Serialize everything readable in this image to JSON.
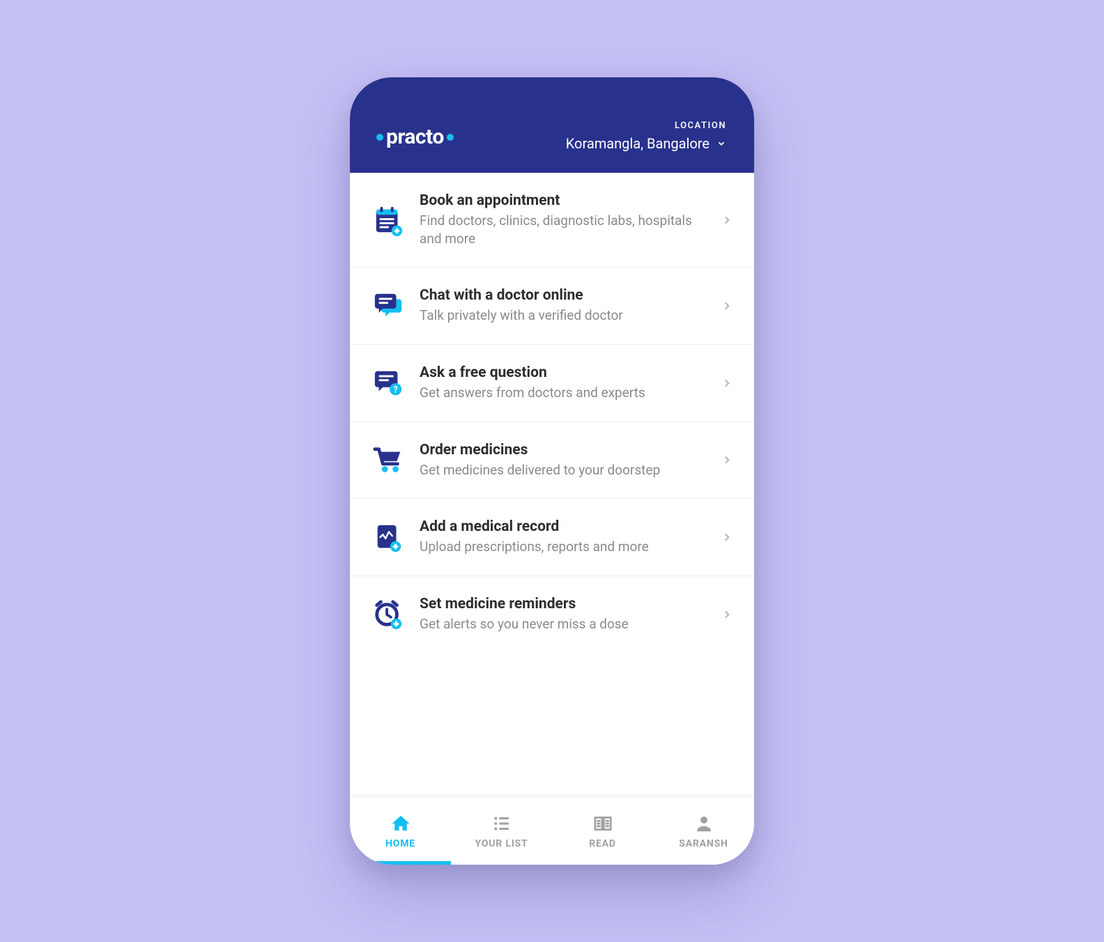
{
  "header": {
    "logo_text": "practo",
    "location_label": "LOCATION",
    "location_value": "Koramangla, Bangalore"
  },
  "items": [
    {
      "icon": "calendar-plus",
      "title": "Book an appointment",
      "subtitle": "Find doctors, clinics, diagnostic labs, hospitals and more"
    },
    {
      "icon": "chat",
      "title": "Chat with a doctor online",
      "subtitle": "Talk privately with a verified doctor"
    },
    {
      "icon": "chat-question",
      "title": "Ask a free question",
      "subtitle": "Get answers from doctors and experts"
    },
    {
      "icon": "cart",
      "title": "Order medicines",
      "subtitle": "Get medicines delivered to your doorstep"
    },
    {
      "icon": "record-plus",
      "title": "Add a medical record",
      "subtitle": "Upload prescriptions, reports and more"
    },
    {
      "icon": "clock-plus",
      "title": "Set medicine reminders",
      "subtitle": "Get alerts so you never miss a dose"
    }
  ],
  "tabs": [
    {
      "icon": "home",
      "label": "HOME",
      "active": true
    },
    {
      "icon": "list",
      "label": "YOUR LIST",
      "active": false
    },
    {
      "icon": "read",
      "label": "READ",
      "active": false
    },
    {
      "icon": "person",
      "label": "SARANSH",
      "active": false
    }
  ]
}
